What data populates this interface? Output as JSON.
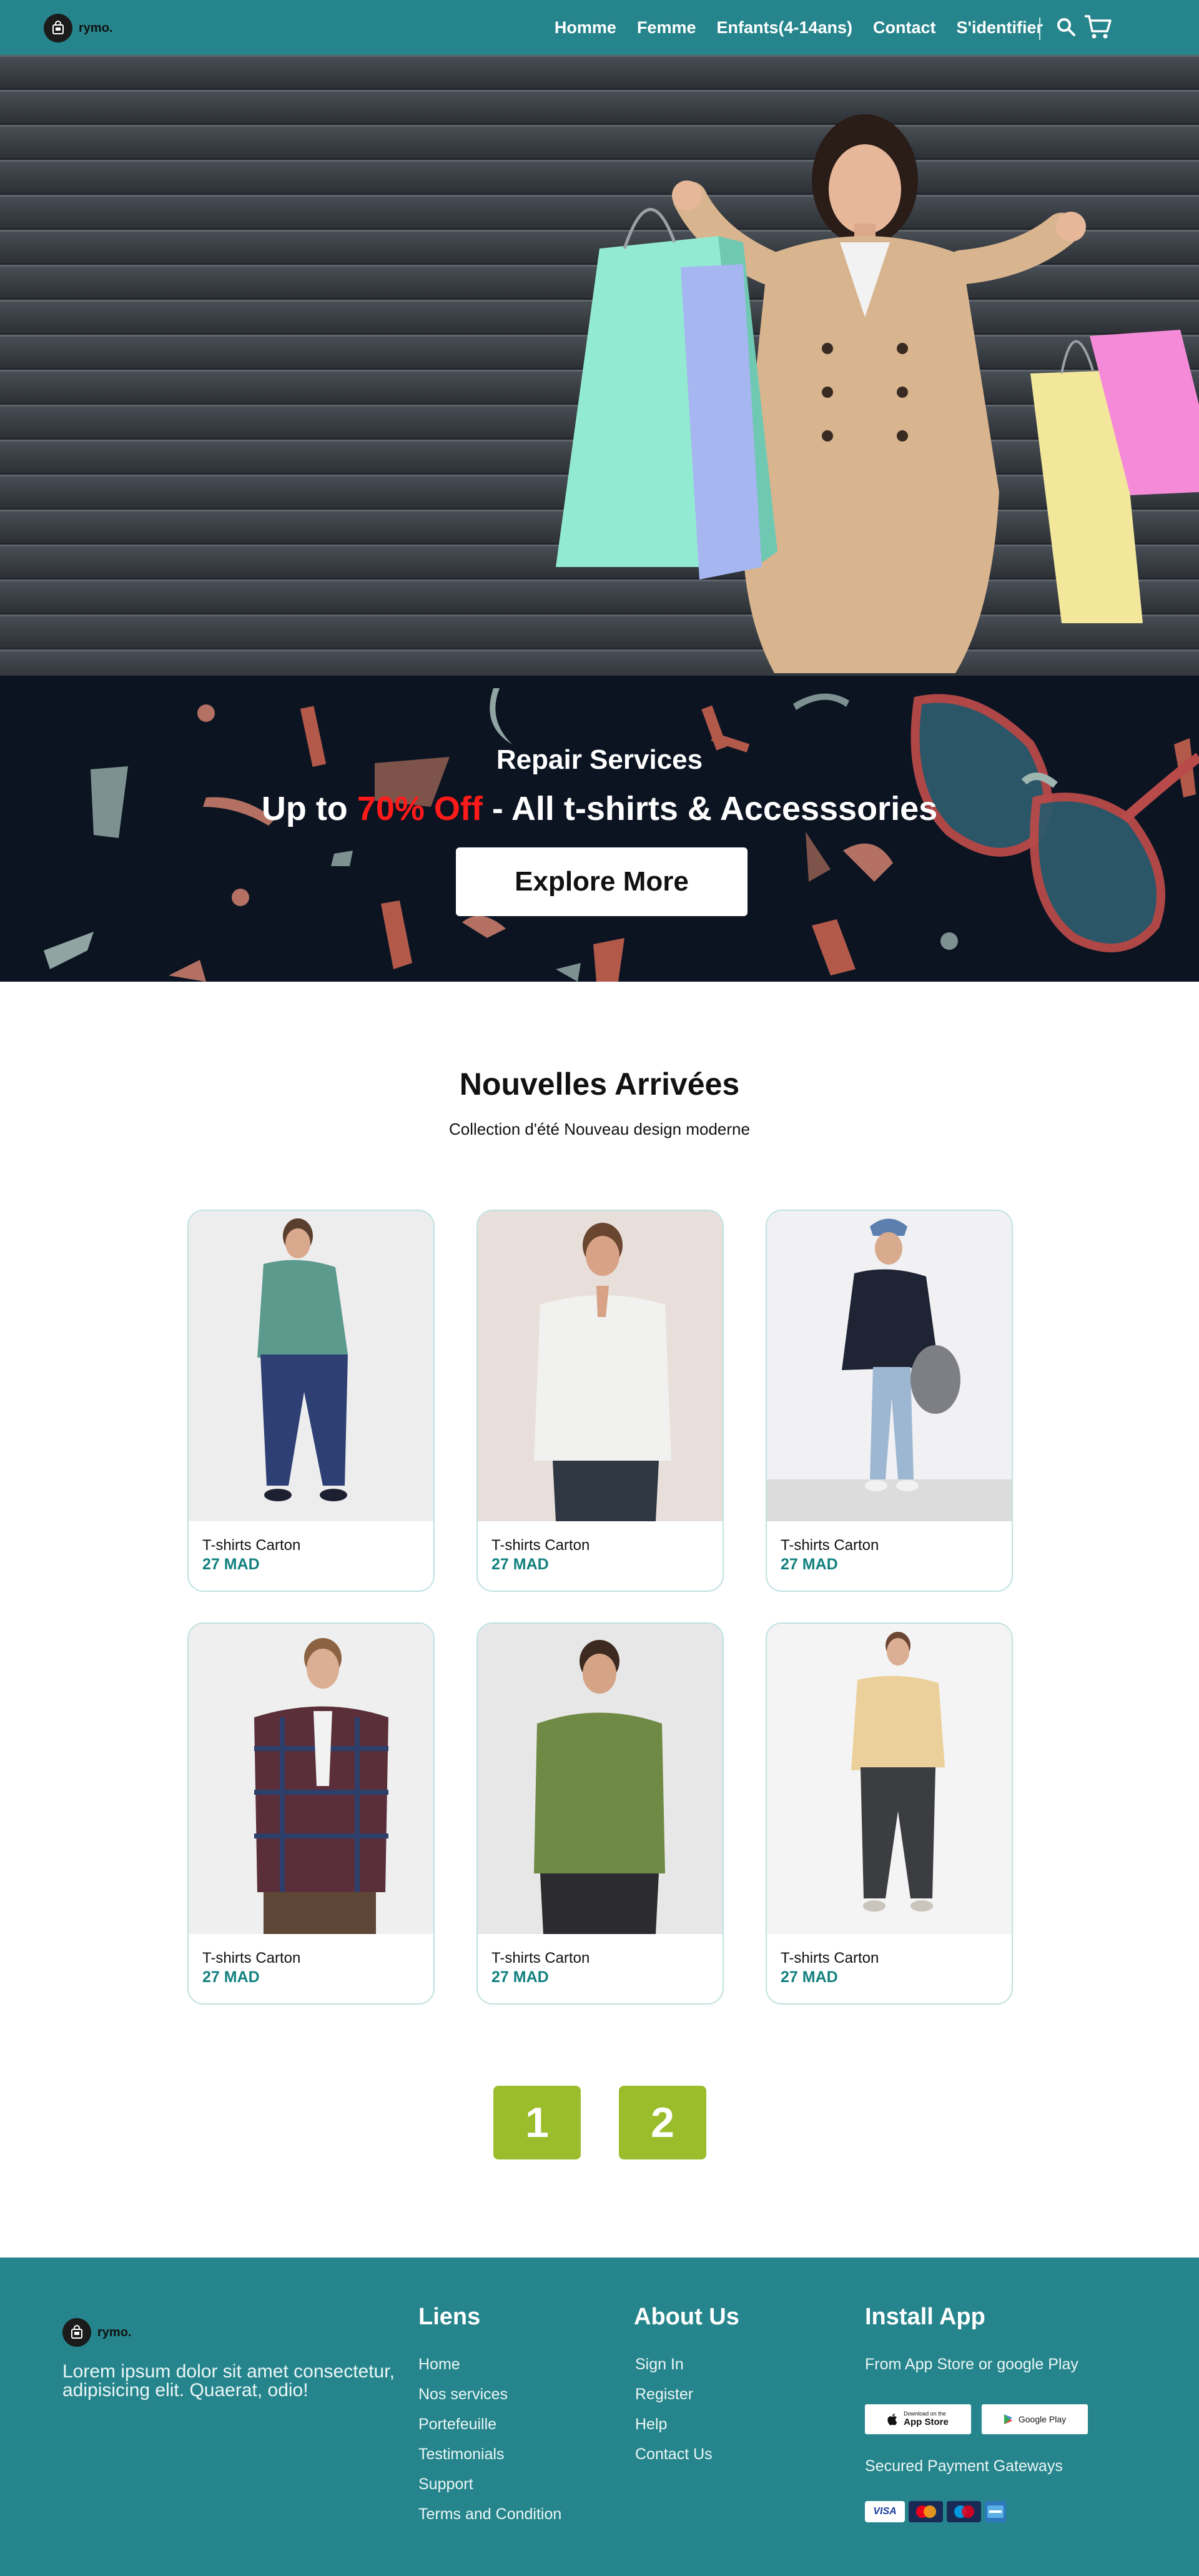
{
  "brand": {
    "name": "rymo."
  },
  "nav": {
    "items": [
      {
        "label": "Homme"
      },
      {
        "label": "Femme"
      },
      {
        "label": "Enfants(4-14ans)"
      },
      {
        "label": "Contact"
      },
      {
        "label": "S'identifier"
      }
    ],
    "icons": [
      "search-icon",
      "cart-icon"
    ]
  },
  "promo": {
    "subtitle": "Repair Services",
    "title_prefix": "Up to ",
    "title_highlight": "70% Off",
    "title_suffix": " - All t-shirts & Accesssories",
    "button": "Explore More",
    "highlight_color": "#ff1a1a"
  },
  "section": {
    "title": "Nouvelles Arrivées",
    "subtitle": "Collection d'été Nouveau design moderne"
  },
  "products": [
    {
      "name": "T-shirts Carton",
      "price": "27 MAD"
    },
    {
      "name": "T-shirts Carton",
      "price": "27 MAD"
    },
    {
      "name": "T-shirts Carton",
      "price": "27 MAD"
    },
    {
      "name": "T-shirts Carton",
      "price": "27 MAD"
    },
    {
      "name": "T-shirts Carton",
      "price": "27 MAD"
    },
    {
      "name": "T-shirts Carton",
      "price": "27 MAD"
    }
  ],
  "pagination": {
    "pages": [
      "1",
      "2"
    ]
  },
  "footer": {
    "brand": "rymo.",
    "description": "Lorem ipsum dolor sit amet consectetur, adipisicing elit. Quaerat, odio!",
    "links_title": "Liens",
    "links": [
      "Home",
      "Nos services",
      "Portefeuille",
      "Testimonials",
      "Support",
      "Terms and Condition"
    ],
    "about_title": "About Us",
    "about": [
      "Sign In",
      "Register",
      "Help",
      "Contact Us"
    ],
    "install_title": "Install App",
    "install_text": "From App Store or google Play",
    "app_store": {
      "small": "Download on the",
      "big": "App Store"
    },
    "google_play": {
      "big": "Google Play"
    },
    "payment_title": "Secured Payment Gateways",
    "payments": [
      "VISA",
      "mastercard",
      "Maestro",
      "AMEX"
    ]
  },
  "colors": {
    "primary": "#26858c",
    "price": "#13817f",
    "pagination": "#9bbd2b",
    "promo_bg": "#0c1422"
  }
}
